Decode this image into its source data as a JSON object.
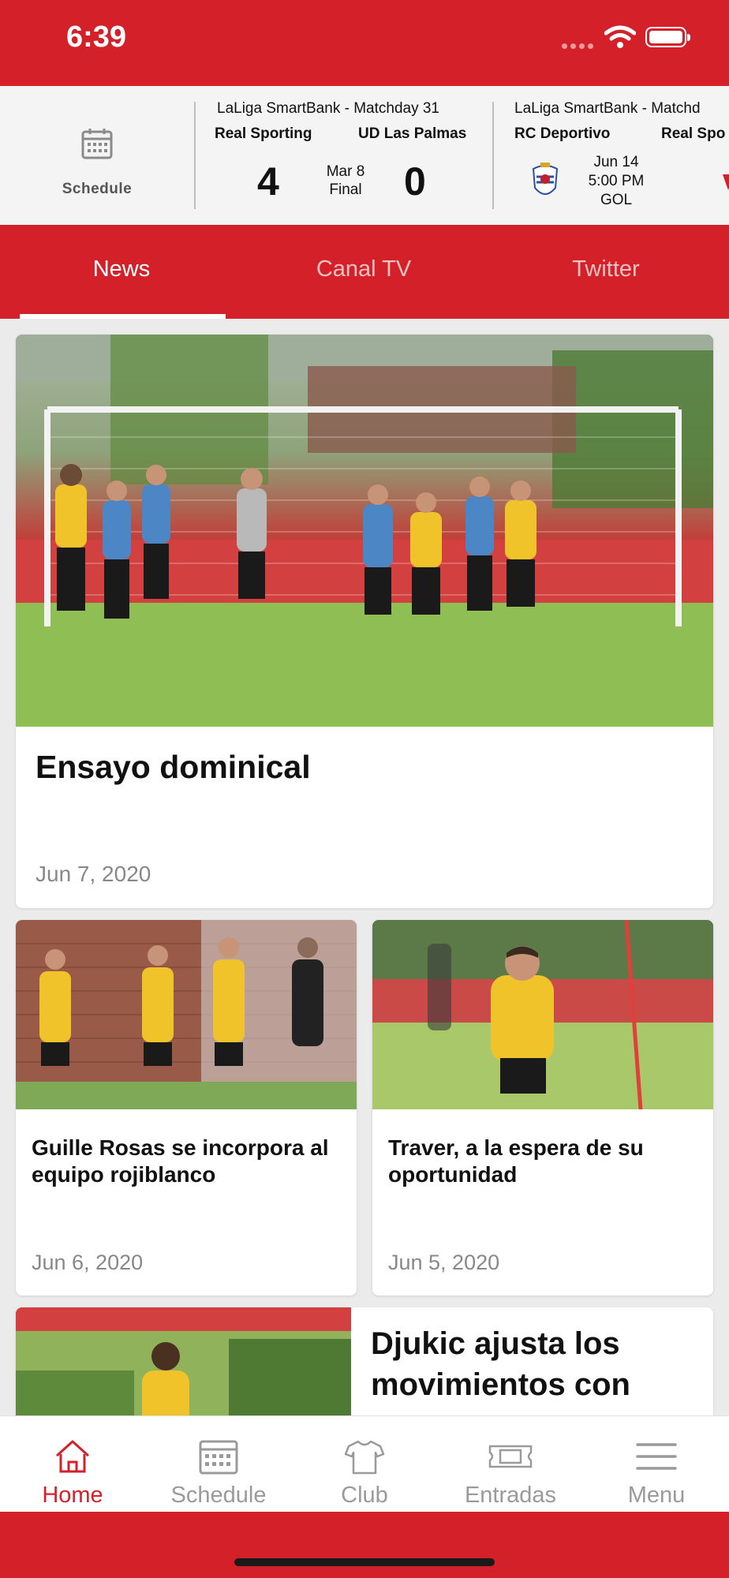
{
  "status": {
    "time": "6:39"
  },
  "scores": {
    "schedule_label": "Schedule",
    "matches": [
      {
        "competition": "LaLiga SmartBank - Matchday 31",
        "home": "Real Sporting",
        "away": "UD Las Palmas",
        "home_score": "4",
        "away_score": "0",
        "date": "Mar 8",
        "status": "Final"
      },
      {
        "competition": "LaLiga SmartBank - Matchd",
        "home": "RC Deportivo",
        "away": "Real Spo",
        "date": "Jun 14",
        "time": "5:00 PM",
        "channel": "GOL"
      }
    ]
  },
  "tabs": [
    {
      "label": "News",
      "active": true
    },
    {
      "label": "Canal TV",
      "active": false
    },
    {
      "label": "Twitter",
      "active": false
    }
  ],
  "articles": [
    {
      "title": "Ensayo dominical",
      "date": "Jun 7, 2020"
    },
    {
      "title": "Guille Rosas se incorpora al equipo rojiblanco",
      "date": "Jun 6, 2020"
    },
    {
      "title": "Traver, a la espera de su oportunidad",
      "date": "Jun 5, 2020"
    },
    {
      "title": "Djukic ajusta los movimientos con"
    }
  ],
  "nav": [
    {
      "label": "Home",
      "icon": "home-icon",
      "active": true
    },
    {
      "label": "Schedule",
      "icon": "calendar-icon",
      "active": false
    },
    {
      "label": "Club",
      "icon": "shirt-icon",
      "active": false
    },
    {
      "label": "Entradas",
      "icon": "ticket-icon",
      "active": false
    },
    {
      "label": "Menu",
      "icon": "menu-icon",
      "active": false
    }
  ],
  "colors": {
    "brand_red": "#d42029",
    "active_nav": "#d42029",
    "inactive_nav": "#9a9a9a"
  }
}
